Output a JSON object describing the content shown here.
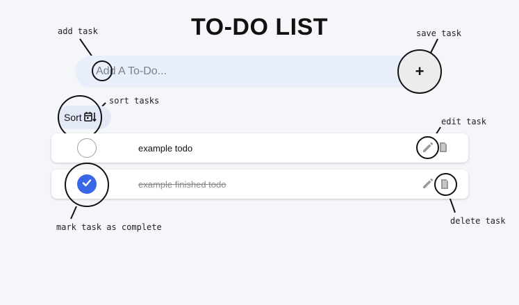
{
  "title": "TO-DO LIST",
  "add": {
    "placeholder": "Add A To-Do...",
    "save_label": "+"
  },
  "sort": {
    "label": "Sort"
  },
  "todos": [
    {
      "text": "example todo",
      "completed": false
    },
    {
      "text": "example finished todo",
      "completed": true
    }
  ],
  "annotations": {
    "add_task": "add task",
    "save_task": "save task",
    "sort_tasks": "sort tasks",
    "edit_task": "edit task",
    "mark_complete": "mark task as complete",
    "delete_task": "delete task"
  },
  "icons": {
    "sort": "calendar-sort-icon",
    "edit": "pencil-icon",
    "delete": "trash-icon",
    "check": "checkmark-icon"
  },
  "colors": {
    "accent": "#3a67e6",
    "background": "#f5f6fa",
    "input_bg": "#e8eefa",
    "icon_gray": "#9a9a9a"
  }
}
